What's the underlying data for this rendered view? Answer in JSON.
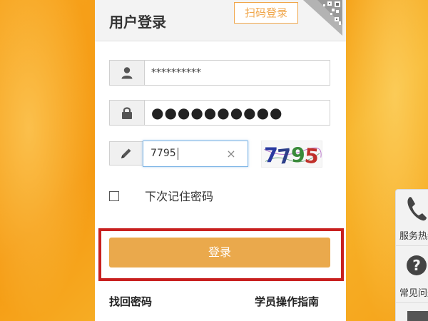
{
  "login": {
    "title": "用户登录",
    "qr_tag": "扫码登录",
    "username_value": "**********",
    "password_value": "●●●●●●●●●●",
    "captcha_value": "7795",
    "captcha_clear": "×",
    "captcha_image_text": "7795",
    "remember_label": "下次记住密码",
    "login_button": "登录",
    "forgot_link": "找回密码",
    "guide_link": "学员操作指南"
  },
  "side": {
    "hotline_label": "服务热线",
    "faq_label": "常见问题"
  },
  "colors": {
    "accent": "#eaa94c",
    "qr_orange": "#f0a64a",
    "highlight_red": "#c8201f",
    "background_orange": "#f7a21c"
  },
  "icons": [
    "user-icon",
    "lock-icon",
    "pencil-icon",
    "qr-code-icon",
    "phone-icon",
    "question-icon"
  ]
}
